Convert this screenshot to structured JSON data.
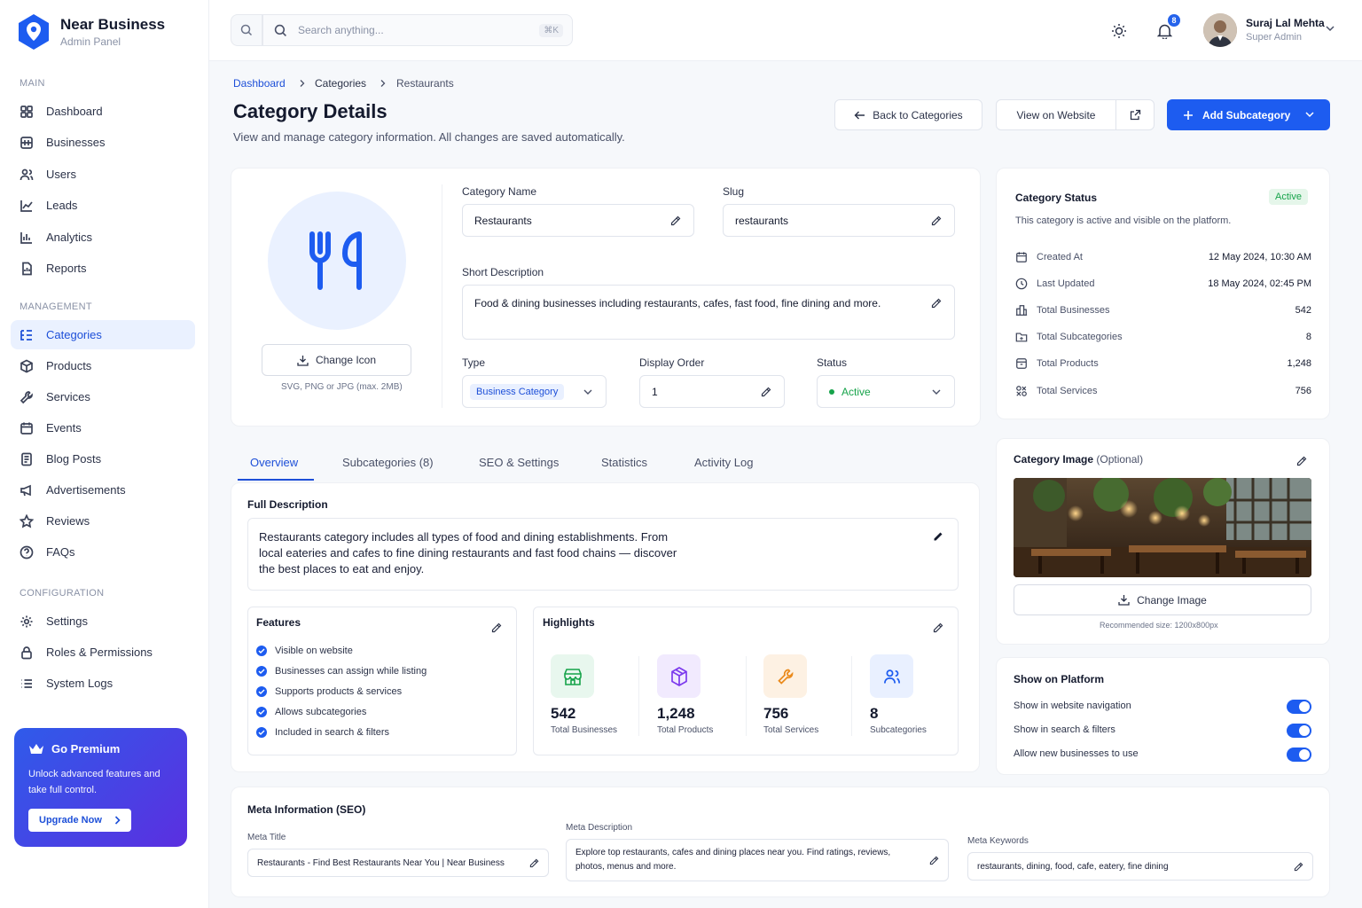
{
  "brand": {
    "name": "Near Business",
    "subtitle": "Admin Panel",
    "color": "#1d5cf0"
  },
  "sidebar": {
    "sections": {
      "main": "MAIN",
      "management": "MANAGEMENT",
      "configuration": "CONFIGURATION"
    },
    "items": [
      {
        "label": "Dashboard",
        "icon": "grid-icon"
      },
      {
        "label": "Businesses",
        "icon": "building-icon"
      },
      {
        "label": "Users",
        "icon": "users-icon"
      },
      {
        "label": "Leads",
        "icon": "trend-icon"
      },
      {
        "label": "Analytics",
        "icon": "bar-chart-icon"
      },
      {
        "label": "Reports",
        "icon": "report-icon"
      },
      {
        "label": "Categories",
        "icon": "list-tree-icon",
        "active": true
      },
      {
        "label": "Products",
        "icon": "box-icon"
      },
      {
        "label": "Services",
        "icon": "wrench-icon"
      },
      {
        "label": "Events",
        "icon": "calendar-icon"
      },
      {
        "label": "Blog Posts",
        "icon": "blog-icon"
      },
      {
        "label": "Advertisements",
        "icon": "megaphone-icon"
      },
      {
        "label": "Reviews",
        "icon": "star-icon"
      },
      {
        "label": "FAQs",
        "icon": "help-icon"
      },
      {
        "label": "Settings",
        "icon": "gear-icon"
      },
      {
        "label": "Roles & Permissions",
        "icon": "lock-icon"
      },
      {
        "label": "System Logs",
        "icon": "list-icon"
      }
    ]
  },
  "premium": {
    "title": "Go Premium",
    "text": "Unlock advanced features and take full control.",
    "button": "Upgrade Now"
  },
  "topbar": {
    "search_placeholder": "Search anything...",
    "shortcut": "⌘K",
    "notifications": "8",
    "user_name": "Suraj Lal Mehta",
    "user_role": "Super Admin"
  },
  "breadcrumb": [
    "Dashboard",
    "Categories",
    "Restaurants"
  ],
  "page": {
    "title": "Category Details",
    "subtitle": "View and manage category information. All changes are saved automatically."
  },
  "actions": {
    "back": "Back to Categories",
    "view": "View on Website",
    "add": "Add Subcategory"
  },
  "form": {
    "change_icon": "Change Icon",
    "icon_hint": "SVG, PNG or JPG (max. 2MB)",
    "name_label": "Category Name",
    "name_value": "Restaurants",
    "slug_label": "Slug",
    "slug_value": "restaurants",
    "short_desc_label": "Short Description",
    "short_desc_value": "Food & dining businesses including restaurants, cafes, fast food, fine dining and more.",
    "type_label": "Type",
    "type_value": "Business Category",
    "order_label": "Display Order",
    "order_value": "1",
    "status_label": "Status",
    "status_value": "Active"
  },
  "tabs": [
    "Overview",
    "Subcategories (8)",
    "SEO & Settings",
    "Statistics",
    "Activity Log"
  ],
  "overview": {
    "full_desc_title": "Full Description",
    "full_desc": "Restaurants category includes all types of food and dining establishments. From local eateries and cafes to fine dining restaurants and fast food chains — discover the best places to eat and enjoy.",
    "features_title": "Features",
    "features": [
      "Visible on website",
      "Businesses can assign while listing",
      "Supports products & services",
      "Allows subcategories",
      "Included in search & filters"
    ],
    "highlights_title": "Highlights",
    "highlights": [
      {
        "value": "542",
        "label": "Total Businesses",
        "icon": "store-icon",
        "color": "#16a34a"
      },
      {
        "value": "1,248",
        "label": "Total Products",
        "icon": "cube-icon",
        "color": "#7c3aed"
      },
      {
        "value": "756",
        "label": "Total Services",
        "icon": "wrench-icon",
        "color": "#ea8a1c"
      },
      {
        "value": "8",
        "label": "Subcategories",
        "icon": "users-icon",
        "color": "#1d5cf0"
      }
    ]
  },
  "seo": {
    "title": "Meta Information (SEO)",
    "meta_title_label": "Meta Title",
    "meta_title": "Restaurants - Find Best Restaurants Near You | Near Business",
    "meta_desc_label": "Meta Description",
    "meta_desc": "Explore top restaurants, cafes and dining places near you. Find ratings, reviews, photos, menus and more.",
    "keywords_label": "Meta Keywords",
    "keywords": "restaurants, dining, food, cafe, eatery, fine dining"
  },
  "status_card": {
    "title": "Category Status",
    "badge": "Active",
    "text": "This category is active and visible on the platform.",
    "rows": [
      {
        "label": "Created At",
        "value": "12 May 2024, 10:30 AM",
        "icon": "calendar-icon"
      },
      {
        "label": "Last Updated",
        "value": "18 May 2024, 02:45 PM",
        "icon": "clock-icon"
      },
      {
        "label": "Total Businesses",
        "value": "542",
        "icon": "building-icon"
      },
      {
        "label": "Total Subcategories",
        "value": "8",
        "icon": "folder-icon"
      },
      {
        "label": "Total Products",
        "value": "1,248",
        "icon": "box-icon"
      },
      {
        "label": "Total Services",
        "value": "756",
        "icon": "services-icon"
      }
    ]
  },
  "image_card": {
    "title": "Category Image",
    "optional": "(Optional)",
    "button": "Change Image",
    "hint": "Recommended size: 1200x800px"
  },
  "platform": {
    "title": "Show on Platform",
    "toggles": [
      {
        "label": "Show in website navigation",
        "on": true
      },
      {
        "label": "Show in search & filters",
        "on": true
      },
      {
        "label": "Allow new businesses to use",
        "on": true
      }
    ]
  }
}
